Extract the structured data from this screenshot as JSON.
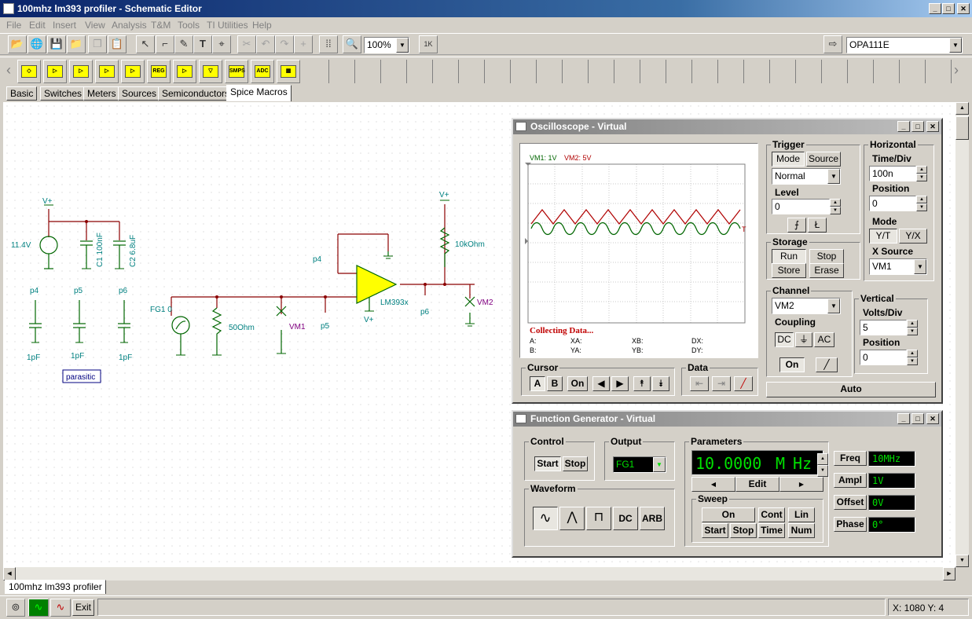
{
  "window": {
    "title": "100mhz lm393 profiler - Schematic Editor",
    "min": "_",
    "max": "□",
    "close": "✕"
  },
  "menu": [
    "File",
    "Edit",
    "Insert",
    "View",
    "Analysis",
    "T&M",
    "Tools",
    "TI Utilities",
    "Help"
  ],
  "toolbar": {
    "zoom": "100%",
    "component": "OPA111E",
    "oneK": "1K"
  },
  "palette": [
    "REG",
    "SMPS",
    "ADC"
  ],
  "tabs": [
    "Basic",
    "Switches",
    "Meters",
    "Sources",
    "Semiconductors",
    "Spice Macros"
  ],
  "schematic": {
    "vplus": "V+",
    "v1": "11.4V",
    "c1": "C1 100nF",
    "c2": "C2 6.8uF",
    "p4": "p4",
    "p5": "p5",
    "p6": "p6",
    "pf": "1pF",
    "parasitic": "parasitic",
    "fg": "FG1 0",
    "r50": "50Ohm",
    "vm1": "VM1",
    "vm2": "VM2",
    "opamp": "LM393x",
    "r10k": "10kOhm"
  },
  "osc": {
    "title": "Oscilloscope - Virtual",
    "legend1": "VM1: 1V",
    "legend2": "VM2: 5V",
    "status": "Collecting Data...",
    "cursors": [
      "A:",
      "B:",
      "XA:",
      "YA:",
      "XB:",
      "YB:",
      "DX:",
      "DY:"
    ],
    "trigger": {
      "label": "Trigger",
      "mode": "Mode",
      "source": "Source",
      "modeValue": "Normal",
      "level": "Level",
      "levelValue": "0"
    },
    "storage": {
      "label": "Storage",
      "run": "Run",
      "stop": "Stop",
      "store": "Store",
      "erase": "Erase"
    },
    "horizontal": {
      "label": "Horizontal",
      "timeDiv": "Time/Div",
      "timeValue": "100n",
      "position": "Position",
      "posValue": "0",
      "mode": "Mode",
      "yt": "Y/T",
      "yx": "Y/X",
      "xsource": "X Source",
      "xsValue": "VM1"
    },
    "channel": {
      "label": "Channel",
      "value": "VM2",
      "coupling": "Coupling",
      "dc": "DC",
      "gnd": "⏚",
      "ac": "AC",
      "on": "On"
    },
    "vertical": {
      "label": "Vertical",
      "voltsDiv": "Volts/Div",
      "voltsValue": "5",
      "position": "Position",
      "posValue": "0"
    },
    "cursor": {
      "label": "Cursor",
      "a": "A",
      "b": "B",
      "on": "On"
    },
    "data": {
      "label": "Data"
    },
    "auto": "Auto"
  },
  "fg": {
    "title": "Function Generator - Virtual",
    "control": "Control",
    "start": "Start",
    "stop": "Stop",
    "output": "Output",
    "outputValue": "FG1",
    "waveform": "Waveform",
    "dc": "DC",
    "arb": "ARB",
    "parameters": "Parameters",
    "display": "10.0000",
    "unitM": "M",
    "unitHz": "Hz",
    "edit": "Edit",
    "sweep": "Sweep",
    "on": "On",
    "cont": "Cont",
    "lin": "Lin",
    "sstart": "Start",
    "sstop": "Stop",
    "time": "Time",
    "num": "Num",
    "freq": "Freq",
    "freqValue": "10MHz",
    "ampl": "Ampl",
    "amplValue": "1V",
    "offset": "Offset",
    "offsetValue": "0V",
    "phase": "Phase",
    "phaseValue": "0°"
  },
  "doctab": "100mhz lm393 profiler",
  "statusbar": {
    "exit": "Exit",
    "coords": "X: 1080 Y: 4"
  }
}
